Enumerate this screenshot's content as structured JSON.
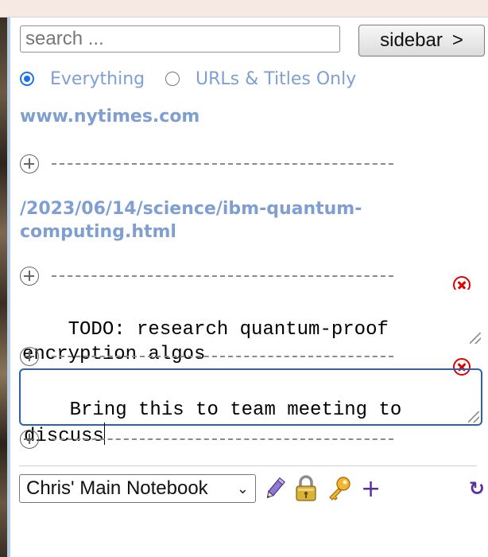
{
  "search": {
    "placeholder": "search ..."
  },
  "sidebar_button": {
    "label": "sidebar",
    "arrow": ">"
  },
  "filters": {
    "everything_label": "Everything",
    "urls_titles_label": "URLs & Titles Only",
    "selected": "Everything"
  },
  "page": {
    "domain": "www.nytimes.com",
    "path": "/2023/06/14/science/ibm-quantum-computing.html"
  },
  "notes": [
    {
      "text": "TODO: research quantum-proof\nencryption algos"
    },
    {
      "text": "Bring this to team meeting to\ndiscuss"
    }
  ],
  "toolbar": {
    "notebook_selected": "Chris' Main Notebook",
    "add_label": "+",
    "refresh_label": "↻"
  },
  "icons": {
    "edit": "pencil-icon",
    "lock": "lock-icon",
    "key": "key-icon",
    "delete": "close-icon",
    "add_note": "plus-circle-icon"
  },
  "colors": {
    "link": "#7f9fd0",
    "focus_border": "#2a61b6",
    "delete": "#e00000",
    "toolbar_icons": "#5b2da0"
  }
}
